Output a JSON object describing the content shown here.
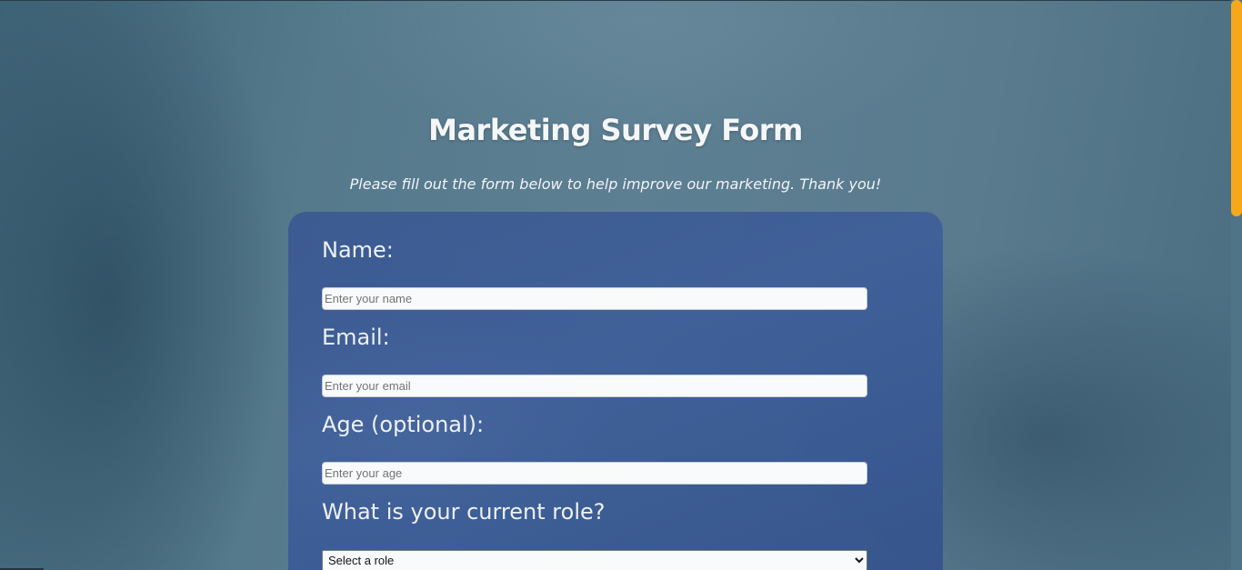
{
  "header": {
    "title": "Marketing Survey Form",
    "description": "Please fill out the form below to help improve our marketing. Thank you!"
  },
  "form": {
    "name": {
      "label": "Name:",
      "placeholder": "Enter your name",
      "value": ""
    },
    "email": {
      "label": "Email:",
      "placeholder": "Enter your email",
      "value": ""
    },
    "age": {
      "label": "Age (optional):",
      "placeholder": "Enter your age",
      "value": ""
    },
    "role": {
      "label": "What is your current role?",
      "selected": "Select a role"
    }
  },
  "colors": {
    "accent": "#f7a81a",
    "card": "#3d5c95",
    "background": "#557a8c"
  }
}
